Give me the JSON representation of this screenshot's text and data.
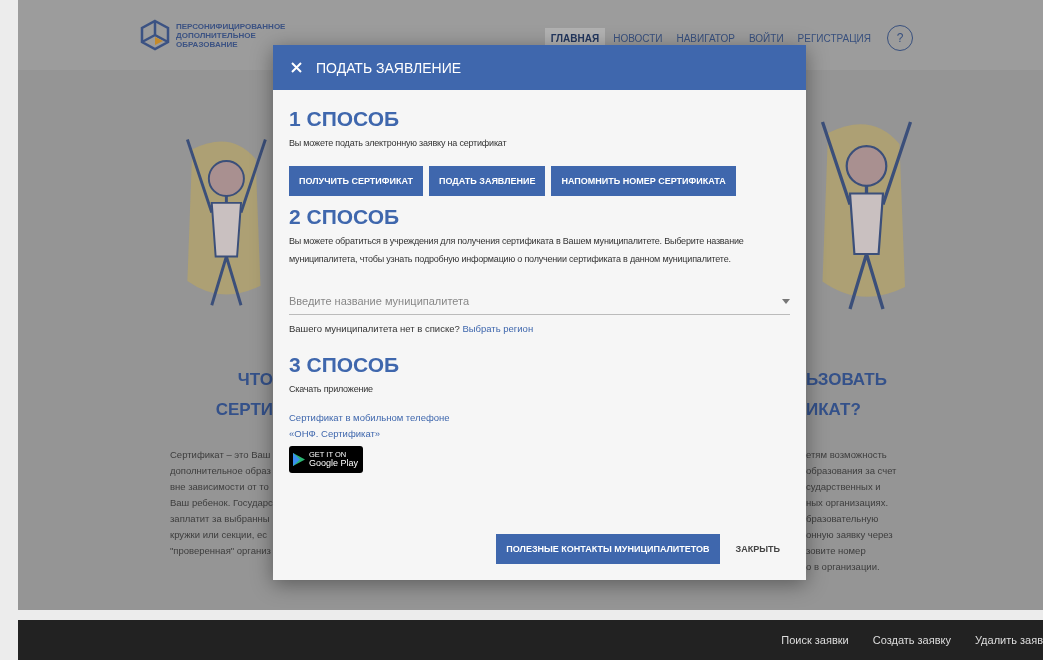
{
  "header": {
    "logo_lines": [
      "ПЕРСОНИФИЦИРОВАННОЕ",
      "ДОПОЛНИТЕЛЬНОЕ",
      "ОБРАЗОВАНИЕ"
    ],
    "nav": [
      {
        "label": "ГЛАВНАЯ",
        "selected": true
      },
      {
        "label": "НОВОСТИ",
        "selected": false
      },
      {
        "label": "НАВИГАТОР",
        "selected": false
      },
      {
        "label": "ВОЙТИ",
        "selected": false
      },
      {
        "label": "РЕГИСТРАЦИЯ",
        "selected": false
      }
    ],
    "help": "?"
  },
  "background": {
    "left": {
      "heading_lines": [
        "ЧТО",
        "СЕРТИ"
      ],
      "paragraph_lines": [
        "Сертификат – это Ваш",
        "дополнительное образ",
        "вне зависимости от то",
        "Ваш ребенок. Государс",
        "заплатит за выбранны",
        "кружки или секции, ес",
        "\"проверенная\" организ"
      ]
    },
    "right": {
      "heading_lines": [
        "ЬЗОВАТЬ",
        "ИКАТ?"
      ],
      "paragraph_lines": [
        "етям возможность",
        "образования за счет",
        "сударственных и",
        "ных организациях.",
        "бразовательную",
        "онную заявку через",
        "зовите номер",
        "о в организации."
      ]
    }
  },
  "dialog": {
    "title": "ПОДАТЬ ЗАЯВЛЕНИЕ",
    "sections": [
      {
        "kind": "buttons",
        "heading": "1 СПОСОБ",
        "text": "Вы можете подать электронную заявку на сертификат",
        "buttons": [
          "ПОЛУЧИТЬ СЕРТИФИКАТ",
          "ПОДАТЬ ЗАЯВЛЕНИЕ",
          "НАПОМНИТЬ НОМЕР СЕРТИФИКАТА"
        ]
      },
      {
        "kind": "select",
        "heading": "2 СПОСОБ",
        "text": "Вы можете обратиться в учреждения для получения сертификата в Вашем муниципалитете. Выберите название муниципалитета, чтобы узнать подробную информацию о получении сертификата в данном муниципалитете.",
        "placeholder": "Введите название муниципалитета",
        "note": "Вашего муниципалитета нет в списке?",
        "link": "Выбрать регион"
      },
      {
        "kind": "app",
        "heading": "3 СПОСОБ",
        "text": "Скачать приложение",
        "links": [
          "Сертификат в мобильном телефоне",
          "«ОНФ. Сертификат»"
        ],
        "badge": {
          "small": "GET IT ON",
          "large": "Google Play"
        }
      }
    ],
    "actions": [
      {
        "label": "ПОЛЕЗНЫЕ КОНТАКТЫ МУНИЦИПАЛИТЕТОВ",
        "kind": "primary"
      },
      {
        "label": "ЗАКРЫТЬ",
        "kind": "flat"
      }
    ]
  },
  "footer_bar": {
    "links": [
      "Поиск заявки",
      "Создать заявку",
      "Удалить заяв"
    ]
  }
}
